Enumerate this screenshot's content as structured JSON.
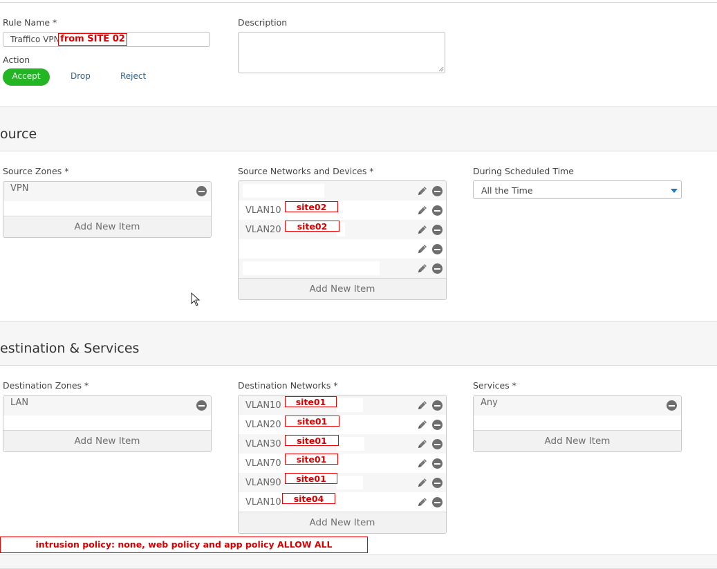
{
  "rule": {
    "name_label": "Rule Name *",
    "name_value": "Traffico VPN",
    "name_annotation": "from SITE 02",
    "description_label": "Description",
    "description_value": "",
    "action_label": "Action",
    "action_accept": "Accept",
    "action_drop": "Drop",
    "action_reject": "Reject"
  },
  "source": {
    "title": "ource",
    "zones_label": "Source Zones *",
    "zones_items": [
      "VPN"
    ],
    "networks_label": "Source Networks and Devices *",
    "networks_items": [
      {
        "text": "",
        "annotation": ""
      },
      {
        "text": "VLAN10",
        "annotation": "site02"
      },
      {
        "text": "VLAN20",
        "annotation": "site02"
      },
      {
        "text": "",
        "annotation": ""
      },
      {
        "text": "",
        "annotation": ""
      }
    ],
    "schedule_label": "During Scheduled Time",
    "schedule_value": "All the Time"
  },
  "destination": {
    "title": "estination & Services",
    "zones_label": "Destination Zones *",
    "zones_items": [
      "LAN"
    ],
    "networks_label": "Destination Networks *",
    "networks_items": [
      {
        "text": "VLAN10",
        "annotation": "site01"
      },
      {
        "text": "VLAN20",
        "annotation": "site01"
      },
      {
        "text": "VLAN30",
        "annotation": "site01"
      },
      {
        "text": "VLAN70",
        "annotation": "site01"
      },
      {
        "text": "VLAN90",
        "annotation": "site01"
      },
      {
        "text": "VLAN10",
        "annotation": "site04"
      }
    ],
    "services_label": "Services *",
    "services_items": [
      "Any"
    ]
  },
  "add_new_item": "Add New Item",
  "bottom_annotation": "intrusion policy: none, web policy and app policy ALLOW ALL",
  "colors": {
    "accept": "#23b523",
    "link": "#2a6496",
    "annotation_red": "#d60000"
  },
  "icons": [
    "pencil-icon",
    "minus-circle-icon",
    "dropdown-caret-icon",
    "mouse-cursor-icon"
  ]
}
